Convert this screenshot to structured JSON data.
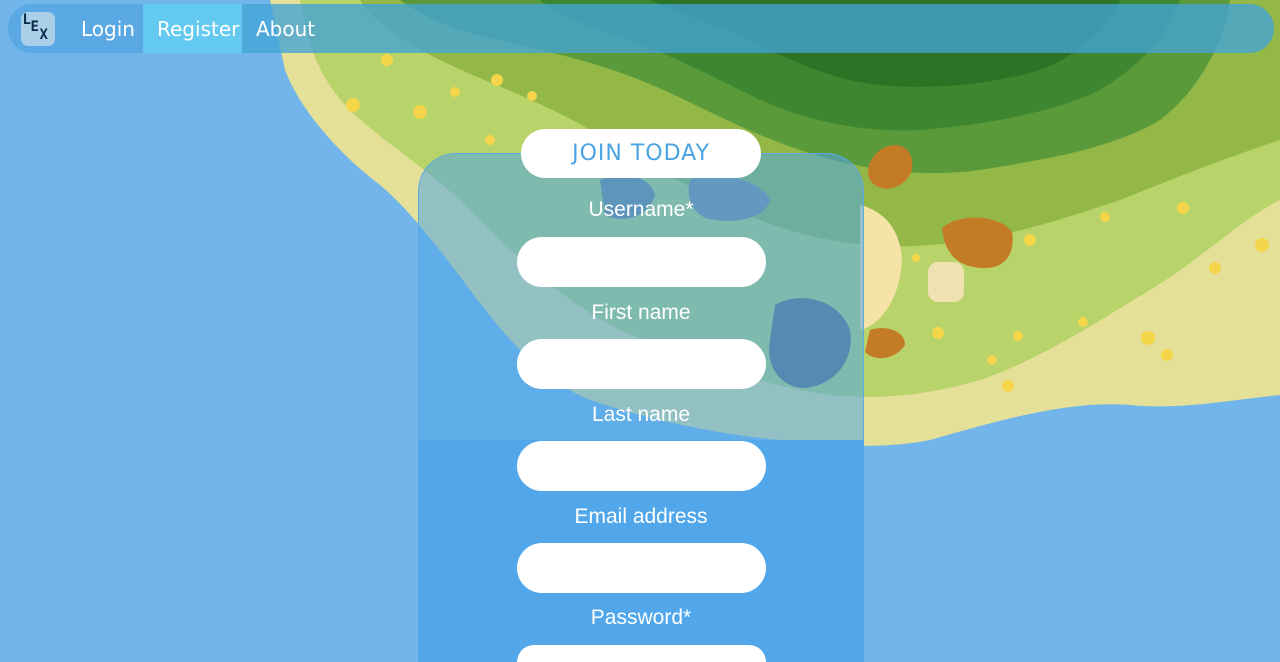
{
  "nav": {
    "logo_letters": [
      "L",
      "E",
      "X"
    ],
    "items": [
      {
        "label": "Login"
      },
      {
        "label": "Register"
      },
      {
        "label": "About"
      }
    ]
  },
  "form": {
    "heading": "JOIN TODAY",
    "fields": [
      {
        "label": "Username*",
        "value": ""
      },
      {
        "label": "First name",
        "value": ""
      },
      {
        "label": "Last name",
        "value": ""
      },
      {
        "label": "Email address",
        "value": ""
      },
      {
        "label": "Password*",
        "value": ""
      }
    ]
  },
  "colors": {
    "ocean": "#71b5ea",
    "navbar": "#43a4d6",
    "active_tab": "#64c9f1",
    "card": "#52a9ea",
    "accent_text": "#4aa3e3"
  }
}
